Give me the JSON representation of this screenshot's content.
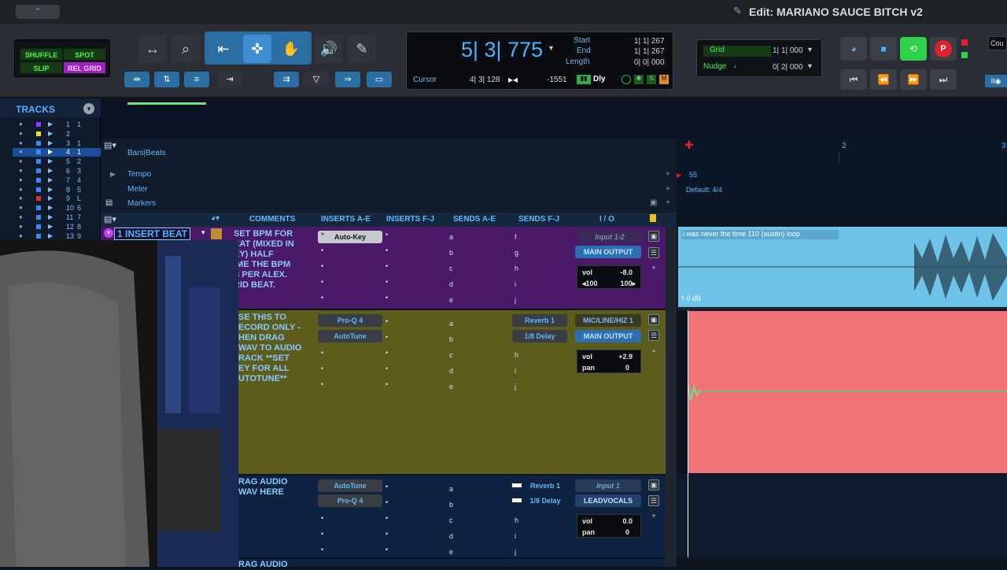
{
  "window": {
    "control": "⌃",
    "title": "Edit: MARIANO SAUCE BITCH v2"
  },
  "edit_modes": {
    "shuffle": "SHUFFLE",
    "spot": "SPOT",
    "slip": "SLIP",
    "grid": "REL GRID"
  },
  "counter": {
    "main": "5| 3| 775",
    "start_label": "Start",
    "start": "1| 1| 267",
    "end_label": "End",
    "end": "1| 1| 267",
    "length_label": "Length",
    "length": "0| 0| 000",
    "cursor_label": "Cursor",
    "cursor": "4| 3| 128",
    "cursor_value": "-1551",
    "dly": "Dly"
  },
  "grid": {
    "grid_label": "Grid",
    "grid_value": "1| 1| 000",
    "nudge_label": "Nudge",
    "nudge_value": "0| 2| 000"
  },
  "transport_right": "Cou",
  "tracks_panel": {
    "title": "TRACKS",
    "items": [
      {
        "num": "1",
        "sub": "1"
      },
      {
        "num": "2",
        "sub": ""
      },
      {
        "num": "3",
        "sub": "1"
      },
      {
        "num": "4",
        "sub": "1"
      },
      {
        "num": "5",
        "sub": "2"
      },
      {
        "num": "6",
        "sub": "3"
      },
      {
        "num": "7",
        "sub": "4"
      },
      {
        "num": "8",
        "sub": "5"
      },
      {
        "num": "9",
        "sub": "L"
      },
      {
        "num": "10",
        "sub": "6"
      },
      {
        "num": "11",
        "sub": "7"
      },
      {
        "num": "12",
        "sub": "8"
      },
      {
        "num": "13",
        "sub": "9"
      }
    ]
  },
  "rulers": {
    "bars_beats": "Bars|Beats",
    "tempo": "Tempo",
    "meter": "Meter",
    "markers": "Markers",
    "tempo_value": "55",
    "meter_value": "Default: 4/4",
    "bar2": "2",
    "bar3": "3"
  },
  "columns": {
    "comments": "COMMENTS",
    "inserts_ae": "INSERTS A-E",
    "inserts_fj": "INSERTS F-J",
    "sends_ae": "SENDS A-E",
    "sends_fj": "SENDS F-J",
    "io": "I / O"
  },
  "tracks": [
    {
      "name": "1 INSERT BEAT",
      "comment": "SET BPM FOR\nEAT (MIXED IN\nEY) HALF\nIME THE BPM\nS PER ALEX.\nRID BEAT.",
      "inserts": [
        "Auto-Key"
      ],
      "sends_fj": [
        "f",
        "g",
        "h",
        "i",
        "j"
      ],
      "sends_fj_labels": [],
      "input": "Input 1-2",
      "output": "MAIN OUTPUT",
      "vol_label": "vol",
      "vol": "-8.0",
      "pan_l": "100",
      "pan_r": "100",
      "clip_name": "i was never the time 110 (austin) loop",
      "clip_gain": "0 dB"
    },
    {
      "comment": "SE THIS TO\nECORD ONLY -\nHEN DRAG\nWAV TO AUDIO\nRACK **SET\nEY FOR ALL\nUTOTUNE**",
      "inserts": [
        "Pro-Q 4",
        "AutoTune"
      ],
      "sends_fj_labels": [
        "Reverb 1",
        "1/8 Delay"
      ],
      "input": "MIC/LINE/HIZ 1",
      "output": "MAIN OUTPUT",
      "vol_label": "vol",
      "vol": "+2.9",
      "pan_label": "pan",
      "pan": "0"
    },
    {
      "comment": "RAG AUDIO\nWAV HERE",
      "inserts": [
        "AutoTune",
        "Pro-Q 4"
      ],
      "sends_fj_labels": [
        "Reverb 1",
        "1/8 Delay"
      ],
      "input": "Input 1",
      "output": "LEADVOCALS",
      "vol_label": "vol",
      "vol": "0.0",
      "pan_label": "pan",
      "pan": "0"
    },
    {
      "comment": "RAG AUDIO"
    }
  ],
  "send_letters_ae": [
    "a",
    "b",
    "c",
    "d",
    "e"
  ],
  "send_letters_fj": [
    "f",
    "g",
    "h",
    "i",
    "j"
  ],
  "colors": {
    "track1": "#4a1a68",
    "track2": "#5c5c1c",
    "track3": "#0d2340",
    "clip1": "#6ec3e8",
    "clip2": "#ee7278"
  }
}
